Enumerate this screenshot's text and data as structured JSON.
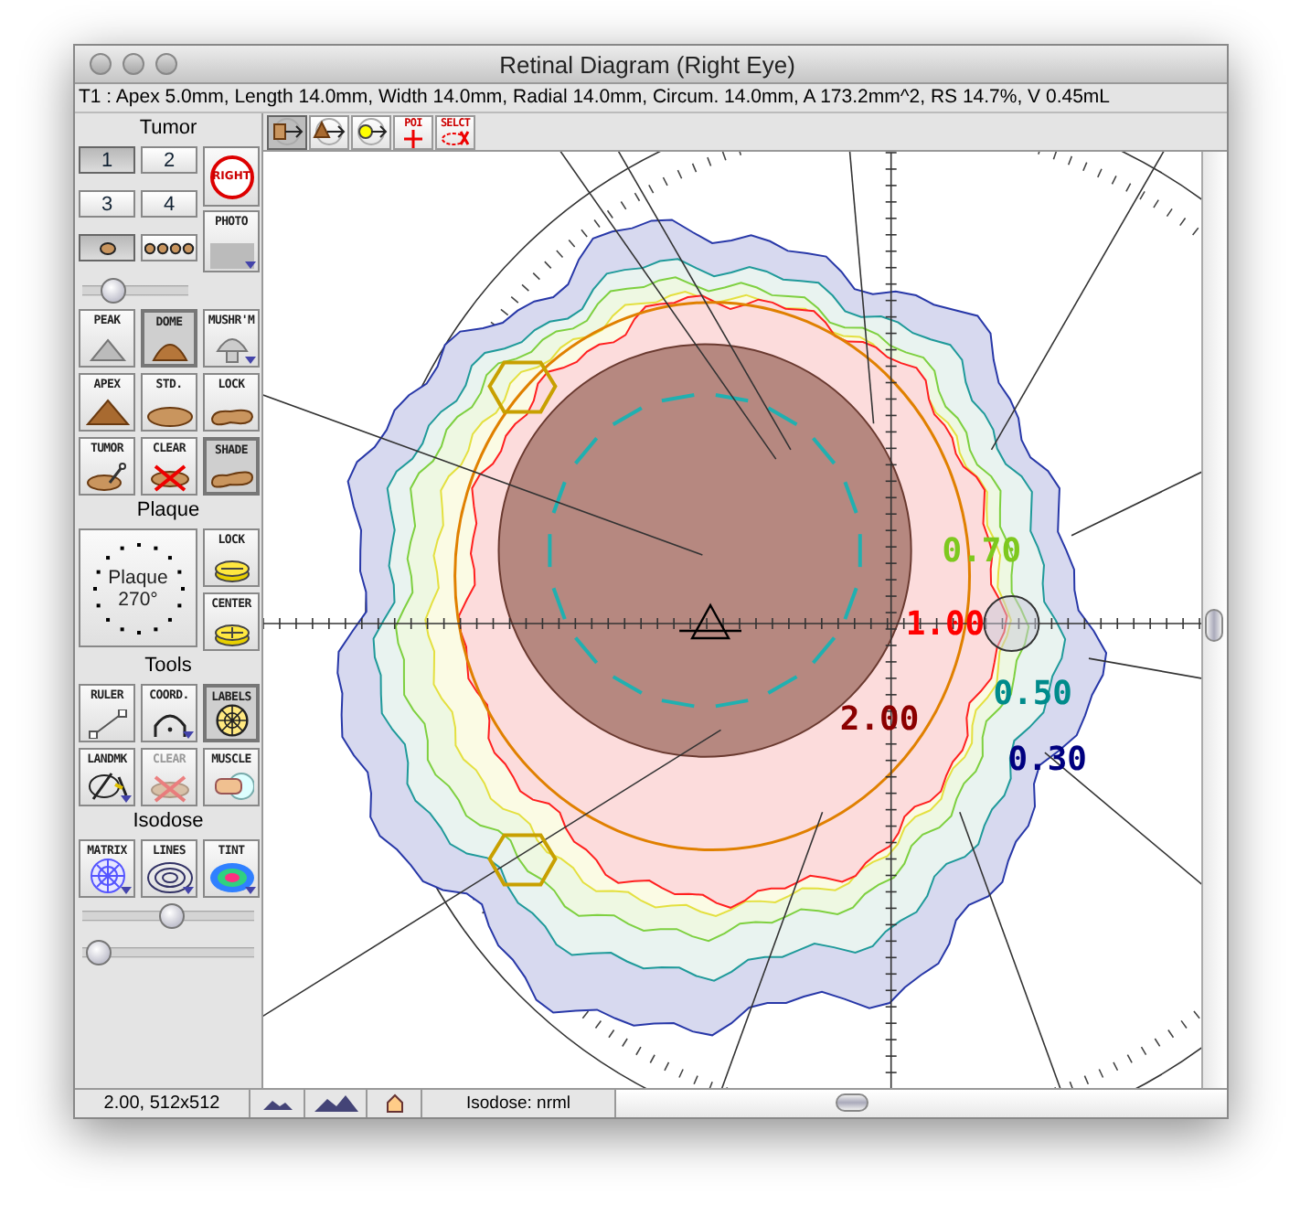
{
  "window": {
    "title": "Retinal Diagram (Right Eye)"
  },
  "info_line": "T1 : Apex 5.0mm, Length 14.0mm, Width 14.0mm, Radial 14.0mm, Circum. 14.0mm, A 173.2mm^2, RS 14.7%, V 0.45mL",
  "toolbar": [
    {
      "kind": "tumor-arrow",
      "selected": true
    },
    {
      "kind": "apex-arrow",
      "selected": false
    },
    {
      "kind": "dot-arrow",
      "selected": false
    },
    {
      "kind": "poi",
      "label": "POI",
      "selected": false
    },
    {
      "kind": "select",
      "label": "SELCT",
      "selected": false
    }
  ],
  "tumor": {
    "heading": "Tumor",
    "numbers": [
      {
        "label": "1",
        "selected": true
      },
      {
        "label": "2",
        "selected": false
      },
      {
        "label": "3",
        "selected": false
      },
      {
        "label": "4",
        "selected": false
      }
    ],
    "markers": [
      {
        "kind": "single",
        "selected": true
      },
      {
        "kind": "multi",
        "selected": false
      }
    ],
    "slider": {
      "level": 0.22
    },
    "eye_button": {
      "label": "RIGHT"
    },
    "photo_button": {
      "label": "PHOTO",
      "has_menu": true
    },
    "tools": [
      {
        "kind": "peak",
        "label": "PEAK",
        "selected": false,
        "has_menu": false
      },
      {
        "kind": "dome",
        "label": "DOME",
        "selected": true,
        "has_menu": false
      },
      {
        "kind": "mushroom",
        "label": "MUSHR'M",
        "selected": false,
        "has_menu": true
      },
      {
        "kind": "apex",
        "label": "APEX",
        "selected": false,
        "has_menu": false
      },
      {
        "kind": "standard",
        "label": "STD.",
        "selected": false,
        "has_menu": false
      },
      {
        "kind": "lock-shape",
        "label": "LOCK",
        "selected": false,
        "has_menu": false
      },
      {
        "kind": "tumor",
        "label": "TUMOR",
        "selected": false,
        "has_menu": false
      },
      {
        "kind": "clear",
        "label": "CLEAR",
        "selected": false,
        "has_menu": false
      },
      {
        "kind": "shade",
        "label": "SHADE",
        "selected": true,
        "has_menu": false
      }
    ]
  },
  "plaque": {
    "heading": "Plaque",
    "dial": {
      "label": "Plaque",
      "angle": "270°"
    },
    "buttons": [
      {
        "kind": "lock",
        "label": "LOCK"
      },
      {
        "kind": "center",
        "label": "CENTER"
      }
    ]
  },
  "tools": {
    "heading": "Tools",
    "buttons": [
      {
        "kind": "ruler",
        "label": "RULER",
        "selected": false,
        "disabled": false,
        "has_menu": false
      },
      {
        "kind": "coord",
        "label": "COORD.",
        "selected": false,
        "disabled": false,
        "has_menu": true
      },
      {
        "kind": "labels",
        "label": "LABELS",
        "selected": true,
        "disabled": false,
        "has_menu": false
      },
      {
        "kind": "landmark",
        "label": "LANDMK",
        "selected": false,
        "disabled": false,
        "has_menu": true
      },
      {
        "kind": "clear",
        "label": "CLEAR",
        "selected": false,
        "disabled": true,
        "has_menu": false
      },
      {
        "kind": "muscle",
        "label": "MUSCLE",
        "selected": false,
        "disabled": false,
        "has_menu": false
      }
    ]
  },
  "isodose": {
    "heading": "Isodose",
    "buttons": [
      {
        "kind": "matrix",
        "label": "MATRIX",
        "has_menu": true
      },
      {
        "kind": "lines",
        "label": "LINES",
        "has_menu": true
      },
      {
        "kind": "tint",
        "label": "TINT",
        "has_menu": true
      }
    ],
    "sliders": [
      {
        "level": 0.52
      },
      {
        "level": 0.03
      }
    ]
  },
  "diagram": {
    "isodose_labels": [
      {
        "text": "0.70",
        "color": "#7ec81e"
      },
      {
        "text": "1.00",
        "color": "#ff0000"
      },
      {
        "text": "0.50",
        "color": "#008b8b"
      },
      {
        "text": "2.00",
        "color": "#8b0000"
      },
      {
        "text": "0.30",
        "color": "#00007f"
      }
    ]
  },
  "status_bar": {
    "zoom": "2.00, 512x512",
    "isodose": "Isodose: nrml"
  }
}
